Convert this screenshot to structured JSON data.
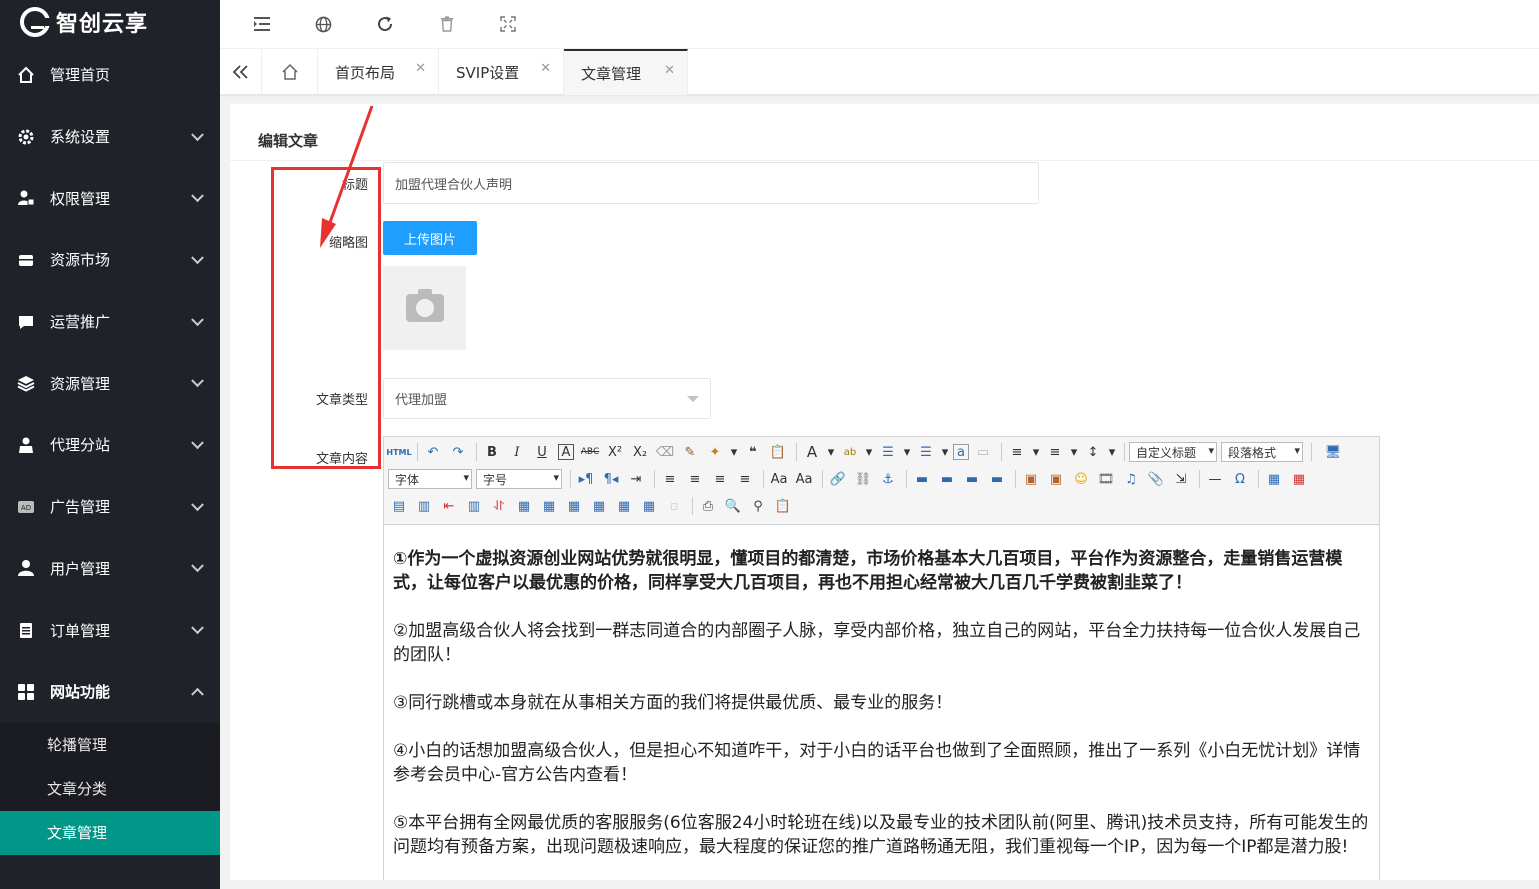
{
  "app": {
    "brand": "智创云享"
  },
  "sidebar": {
    "items": [
      {
        "label": "管理首页",
        "icon": "home-icon",
        "expandable": false
      },
      {
        "label": "系统设置",
        "icon": "gear-icon",
        "expandable": true
      },
      {
        "label": "权限管理",
        "icon": "user-lock-icon",
        "expandable": true
      },
      {
        "label": "资源市场",
        "icon": "store-icon",
        "expandable": true
      },
      {
        "label": "运营推广",
        "icon": "chat-icon",
        "expandable": true
      },
      {
        "label": "资源管理",
        "icon": "stack-icon",
        "expandable": true
      },
      {
        "label": "代理分站",
        "icon": "agent-icon",
        "expandable": true
      },
      {
        "label": "广告管理",
        "icon": "ad-icon",
        "expandable": true
      },
      {
        "label": "用户管理",
        "icon": "user-icon",
        "expandable": true
      },
      {
        "label": "订单管理",
        "icon": "list-icon",
        "expandable": true
      },
      {
        "label": "网站功能",
        "icon": "grid-icon",
        "expandable": true,
        "expanded": true
      }
    ],
    "subitems": [
      {
        "label": "轮播管理"
      },
      {
        "label": "文章分类"
      },
      {
        "label": "文章管理",
        "active": true
      }
    ]
  },
  "topbar": {
    "icons": [
      "menu-fold-icon",
      "globe-icon",
      "refresh-icon",
      "trash-icon",
      "fullscreen-icon"
    ]
  },
  "tabs": [
    {
      "label": "首页布局"
    },
    {
      "label": "SVIP设置"
    },
    {
      "label": "文章管理",
      "active": true
    }
  ],
  "form": {
    "card_title": "编辑文章",
    "title_label": "标题",
    "title_value": "加盟代理合伙人声明",
    "thumb_label": "缩略图",
    "upload_button": "上传图片",
    "type_label": "文章类型",
    "type_value": "代理加盟",
    "content_label": "文章内容"
  },
  "editor": {
    "font_combo": "字体",
    "size_combo": "字号",
    "heading_combo": "自定义标题",
    "paragraph_combo": "段落格式",
    "paragraphs": [
      {
        "text": "①作为一个虚拟资源创业网站优势就很明显，懂项目的都清楚，市场价格基本大几百项目，平台作为资源整合，走量销售运营模式，让每位客户以最优惠的价格，同样享受大几百项目，再也不用担心经常被大几百几千学费被割韭菜了！",
        "bold": true
      },
      {
        "text": "②加盟高级合伙人将会找到一群志同道合的内部圈子人脉，享受内部价格，独立自己的网站，平台全力扶持每一位合伙人发展自己的团队！",
        "bold": false
      },
      {
        "text": "③同行跳槽或本身就在从事相关方面的我们将提供最优质、最专业的服务！",
        "bold": false
      },
      {
        "text": "④小白的话想加盟高级合伙人，但是担心不知道咋干，对于小白的话平台也做到了全面照顾，推出了一系列《小白无忧计划》详情参考会员中心-官方公告内查看！",
        "bold": false
      },
      {
        "text": "⑤本平台拥有全网最优质的客服服务(6位客服24小时轮班在线)以及最专业的技术团队前(阿里、腾讯)技术员支持，所有可能发生的问题均有预备方案，出现问题极速响应，最大程度的保证您的推广道路畅通无阻，我们重视每一个IP，因为每一个IP都是潜力股!",
        "bold": false
      }
    ]
  },
  "colors": {
    "sidebar_bg": "#20222a",
    "active_green": "#009688",
    "upload_blue": "#1e9fff",
    "annotation_red": "#e8322f"
  }
}
